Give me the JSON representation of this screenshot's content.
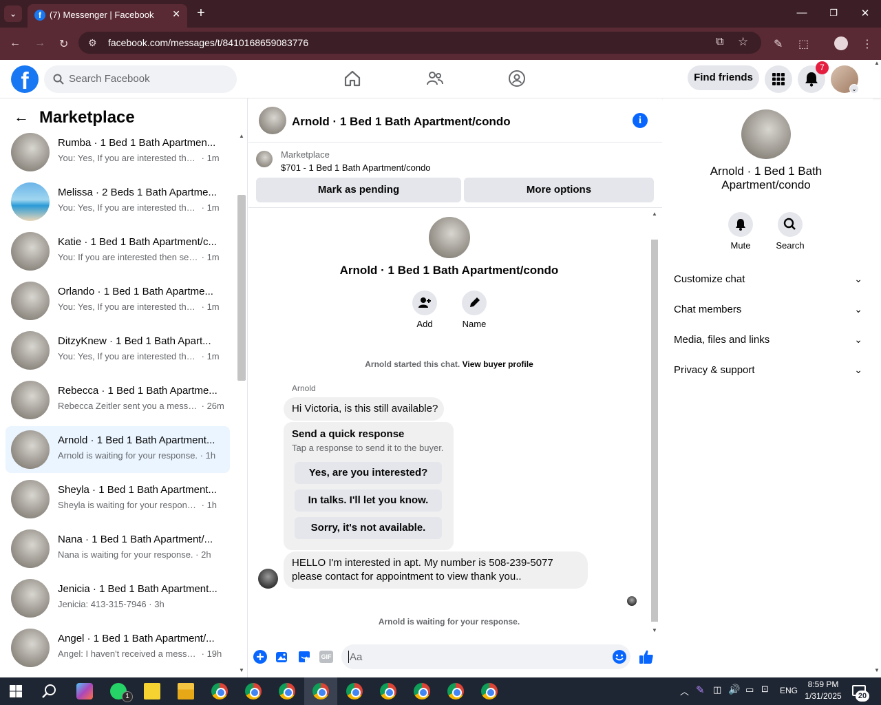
{
  "browser": {
    "tab_title": "(7) Messenger | Facebook",
    "url": "facebook.com/messages/t/8410168659083776"
  },
  "header": {
    "search_placeholder": "Search Facebook",
    "find_friends": "Find friends",
    "notification_count": "7"
  },
  "sidebar": {
    "title": "Marketplace",
    "conversations": [
      {
        "name": "Rumba · 1 Bed 1 Bath Apartmen...",
        "preview": "You: Yes, If you are interested then...",
        "time": "· 1m",
        "image": "room"
      },
      {
        "name": "Melissa · 2 Beds 1 Bath Apartme...",
        "preview": "You: Yes, If you are interested then...",
        "time": "· 1m",
        "image": "pool"
      },
      {
        "name": "Katie · 1 Bed 1 Bath Apartment/c...",
        "preview": "You: If you are interested then sen...",
        "time": "· 1m",
        "image": "room"
      },
      {
        "name": "Orlando · 1 Bed 1 Bath Apartme...",
        "preview": "You: Yes, If you are interested then...",
        "time": "· 1m",
        "image": "room"
      },
      {
        "name": "DitzyKnew · 1 Bed 1 Bath Apart...",
        "preview": "You: Yes, If you are interested then...",
        "time": "· 1m",
        "image": "room"
      },
      {
        "name": "Rebecca · 1 Bed 1 Bath Apartme...",
        "preview": "Rebecca Zeitler sent you a messa...",
        "time": "· 26m",
        "image": "room"
      },
      {
        "name": "Arnold · 1 Bed 1 Bath Apartment...",
        "preview": "Arnold is waiting for your response.",
        "time": "· 1h",
        "image": "room",
        "selected": true
      },
      {
        "name": "Sheyla · 1 Bed 1 Bath Apartment...",
        "preview": "Sheyla is waiting for your response.",
        "time": "· 1h",
        "image": "room"
      },
      {
        "name": "Nana · 1 Bed 1 Bath Apartment/...",
        "preview": "Nana is waiting for your response.",
        "time": "· 2h",
        "image": "room"
      },
      {
        "name": "Jenicia · 1 Bed 1 Bath Apartment...",
        "preview": "Jenicia: 413-315-7946",
        "time": "· 3h",
        "image": "room"
      },
      {
        "name": "Angel · 1 Bed 1 Bath Apartment/...",
        "preview": "Angel: I haven't received a messa...",
        "time": "· 19h",
        "image": "room"
      }
    ]
  },
  "chat": {
    "title": "Arnold · 1 Bed 1 Bath Apartment/condo",
    "listing_label": "Marketplace",
    "listing_desc": "$701 - 1 Bed 1 Bath Apartment/condo",
    "mark_pending": "Mark as pending",
    "more_options": "More options",
    "profile_title": "Arnold · 1 Bed 1 Bath Apartment/condo",
    "add_label": "Add",
    "name_label": "Name",
    "started_text": "Arnold started this chat.",
    "view_buyer": "View buyer profile",
    "sender_name": "Arnold",
    "msg1": "Hi Victoria, is this still available?",
    "quick_title": "Send a quick response",
    "quick_sub": "Tap a response to send it to the buyer.",
    "quick_responses": [
      "Yes, are you interested?",
      "In talks. I'll let you know.",
      "Sorry, it's not available."
    ],
    "msg2_line1": "HELLO I'm interested in apt. My number is 508-239-5077",
    "msg2_line2": "please contact for appointment to view thank you..",
    "waiting": "Arnold is waiting for your response.",
    "input_placeholder": "Aa"
  },
  "details": {
    "title_line1": "Arnold · 1 Bed 1 Bath",
    "title_line2": "Apartment/condo",
    "mute": "Mute",
    "search": "Search",
    "sections": [
      "Customize chat",
      "Chat members",
      "Media, files and links",
      "Privacy & support"
    ]
  },
  "taskbar": {
    "time": "8:59 PM",
    "date": "1/31/2025",
    "language": "ENG",
    "notif_count": "20",
    "whatsapp_badge": "1"
  }
}
